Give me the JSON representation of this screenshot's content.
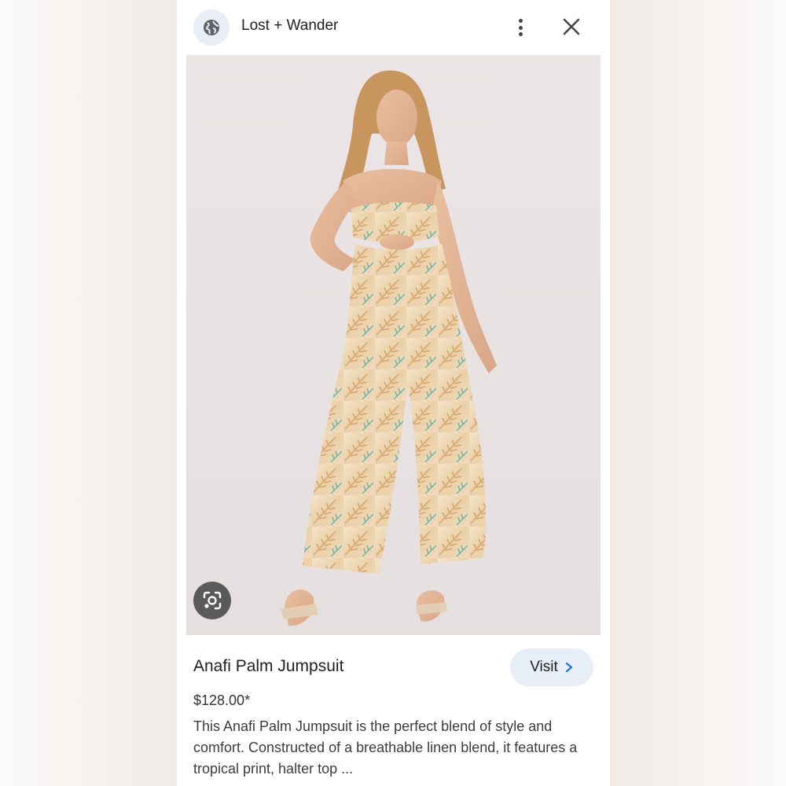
{
  "header": {
    "site_icon": "globe-icon",
    "site_name": "Lost + Wander",
    "more_icon": "more-vertical-icon",
    "close_icon": "close-icon"
  },
  "image": {
    "lens_icon": "google-lens-icon"
  },
  "product": {
    "title": "Anafi Palm Jumpsuit",
    "price": "$128.00*",
    "description": "This Anafi Palm Jumpsuit is the perfect blend of style and comfort. Constructed of a breathable linen blend, it features a tropical print, halter top ...",
    "visit_label": "Visit",
    "visit_icon": "chevron-right-icon"
  },
  "colors": {
    "accent": "#1a73e8",
    "button_bg": "#e8eef8"
  }
}
